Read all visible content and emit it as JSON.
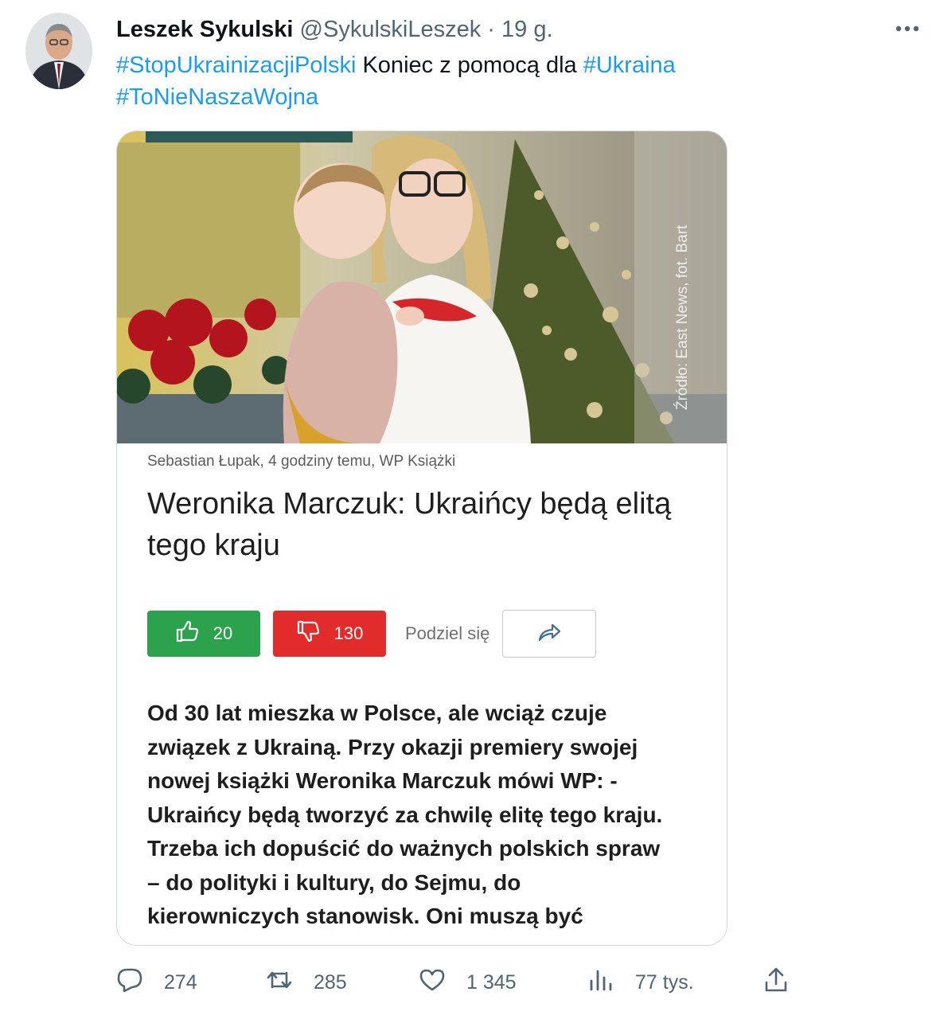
{
  "tweet": {
    "author_name": "Leszek Sykulski",
    "handle": "@SykulskiLeszek",
    "separator": "·",
    "time": "19 g.",
    "text_segments": [
      {
        "text": "#StopUkrainizacjiPolski",
        "type": "hashtag"
      },
      {
        "text": " Koniec z pomocą dla ",
        "type": "text"
      },
      {
        "text": "#Ukraina",
        "type": "hashtag"
      },
      {
        "text": "#ToNieNaszaWojna",
        "type": "hashtag"
      }
    ]
  },
  "media": {
    "photo_caption": "Źródło: East News, fot. Bart",
    "byline": "Sebastian Łupak, 4 godziny temu, WP Książki",
    "headline": "Weronika Marczuk: Ukraińcy będą elitą tego kraju",
    "like_count": "20",
    "dislike_count": "130",
    "share_label": "Podziel się",
    "body_lines": [
      "Od 30 lat mieszka w Polsce, ale wciąż czuje",
      "związek z Ukrainą. Przy okazji premiery swojej",
      "nowej książki Weronika Marczuk mówi WP: -",
      "Ukraińcy będą tworzyć za chwilę elitę tego kraju.",
      "Trzeba ich dopuścić do ważnych polskich spraw",
      "– do polityki i kultury, do Sejmu, do",
      "kierowniczych stanowisk. Oni muszą być"
    ]
  },
  "actions": {
    "replies": "274",
    "retweets": "285",
    "likes": "1 345",
    "views": "77 tys."
  },
  "colors": {
    "link": "#1d9bf0",
    "secondary": "#536471",
    "like_green": "#2ca24c",
    "dislike_red": "#e22b2b"
  },
  "icons": [
    "more-icon",
    "thumbs-up-icon",
    "thumbs-down-icon",
    "share-arrow-icon",
    "reply-icon",
    "retweet-icon",
    "like-icon",
    "views-icon",
    "share-icon"
  ]
}
